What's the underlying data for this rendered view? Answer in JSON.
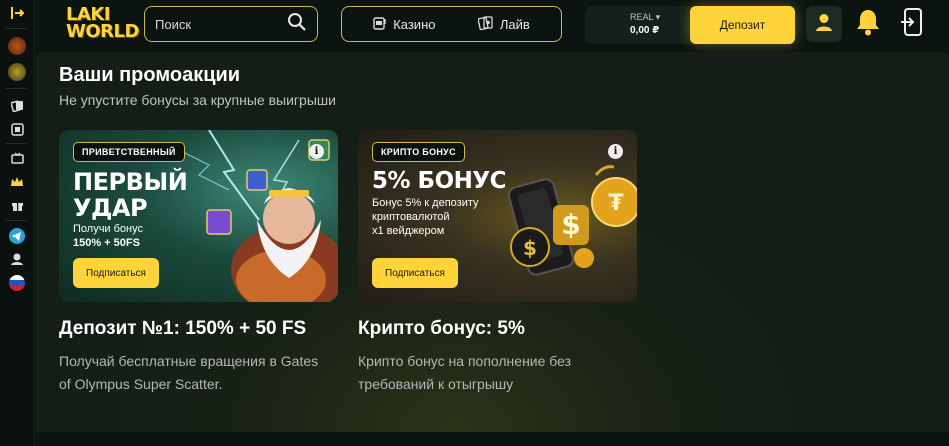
{
  "header": {
    "logo_line1": "LAKI",
    "logo_line2": "WORLD",
    "search_placeholder": "Поиск",
    "tabs": [
      {
        "label": "Казино",
        "icon": "slot-machine-icon"
      },
      {
        "label": "Лайв",
        "icon": "live-cards-icon"
      }
    ],
    "balance": {
      "label": "REAL ▾",
      "value": "0,00 ₽"
    },
    "deposit_label": "Депозит",
    "accent_color": "#ffd43a"
  },
  "sidebar": {
    "items": [
      {
        "icon": "logout-icon"
      },
      {
        "icon": "avatar-game-1-icon"
      },
      {
        "icon": "avatar-game-2-icon"
      },
      {
        "icon": "cards-icon"
      },
      {
        "icon": "roulette-icon"
      },
      {
        "icon": "tv-icon"
      },
      {
        "icon": "crown-icon"
      },
      {
        "icon": "gift-icon"
      },
      {
        "icon": "telegram-icon"
      },
      {
        "icon": "support-icon"
      },
      {
        "icon": "russia-flag-icon"
      }
    ]
  },
  "main": {
    "title": "Ваши промоакции",
    "subtitle": "Не упустите бонусы за крупные выигрыши",
    "promos": [
      {
        "badge": "ПРИВЕТСТВЕННЫЙ",
        "headline_1": "ПЕРВЫЙ",
        "headline_2": "УДАР",
        "detail_1": "Получи бонус",
        "detail_2": "150% + 50FS",
        "button": "Подписаться",
        "title": "Депозит №1: 150% + 50 FS",
        "description": "Получай бесплатные вращения в Gates of Olympus Super Scatter."
      },
      {
        "badge": "КРИПТО БОНУС",
        "headline_1": "5% БОНУС",
        "detail_1": "Бонус 5% к депозиту",
        "detail_2": "криптовалютой",
        "detail_3": "x1 вейджером",
        "button": "Подписаться",
        "title": "Крипто бонус: 5%",
        "description": "Крипто бонус на пополнение без требований к отыгрышу"
      }
    ]
  }
}
